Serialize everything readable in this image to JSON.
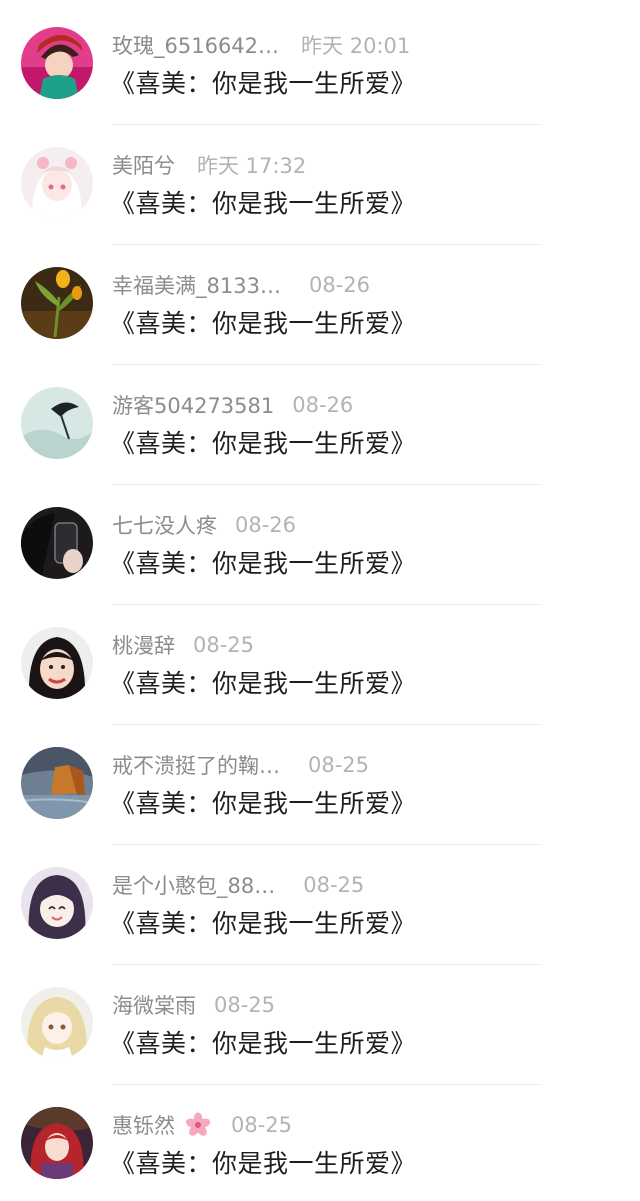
{
  "comments": [
    {
      "username": "玫瑰_6516642…",
      "time": "昨天 20:01",
      "message": "《喜美：你是我一生所爱》",
      "avatar": "avatar-girl-red-hat"
    },
    {
      "username": "美陌兮",
      "time": "昨天 17:32",
      "message": "《喜美：你是我一生所爱》",
      "avatar": "avatar-anime-pink-girl"
    },
    {
      "username": "幸福美满_8133…",
      "time": "08-26",
      "message": "《喜美：你是我一生所爱》",
      "avatar": "avatar-tulip-flower"
    },
    {
      "username": "游客504273581",
      "time": "08-26",
      "message": "《喜美：你是我一生所爱》",
      "avatar": "avatar-ink-bird"
    },
    {
      "username": "七七没人疼",
      "time": "08-26",
      "message": "《喜美：你是我一生所爱》",
      "avatar": "avatar-phone-selfie"
    },
    {
      "username": "桃漫辞",
      "time": "08-25",
      "message": "《喜美：你是我一生所爱》",
      "avatar": "avatar-smiling-girl"
    },
    {
      "username": "戒不溃挺了的鞠…",
      "time": "08-25",
      "message": "《喜美：你是我一生所爱》",
      "avatar": "avatar-autumn-lake"
    },
    {
      "username": "是个小憨包_88…",
      "time": "08-25",
      "message": "《喜美：你是我一生所爱》",
      "avatar": "avatar-anime-dark-hair"
    },
    {
      "username": "海微棠雨",
      "time": "08-25",
      "message": "《喜美：你是我一生所爱》",
      "avatar": "avatar-anime-blonde"
    },
    {
      "username": "惠铄然",
      "time": "08-25",
      "message": "《喜美：你是我一生所爱》",
      "avatar": "avatar-anime-red-hair",
      "emoji": "cherry-blossom-emoji"
    }
  ]
}
